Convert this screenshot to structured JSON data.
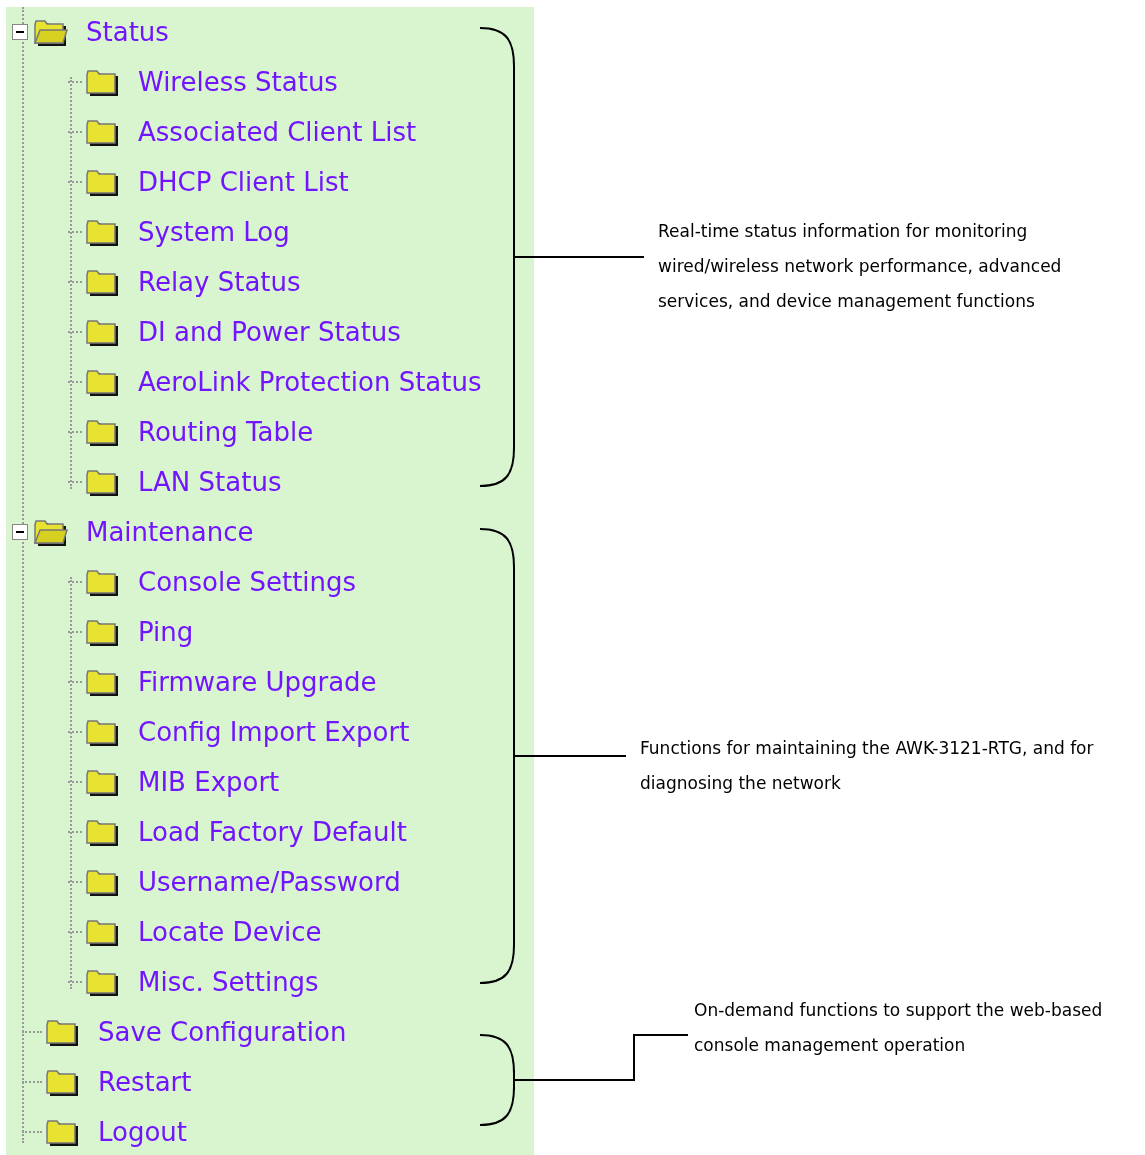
{
  "tree": [
    {
      "label": "Status",
      "expanded": true,
      "children": [
        {
          "label": "Wireless Status"
        },
        {
          "label": "Associated Client List"
        },
        {
          "label": "DHCP Client List"
        },
        {
          "label": "System Log"
        },
        {
          "label": "Relay Status"
        },
        {
          "label": "DI and Power Status"
        },
        {
          "label": "AeroLink Protection Status"
        },
        {
          "label": "Routing Table"
        },
        {
          "label": "LAN Status"
        }
      ]
    },
    {
      "label": "Maintenance",
      "expanded": true,
      "children": [
        {
          "label": "Console Settings"
        },
        {
          "label": "Ping"
        },
        {
          "label": "Firmware Upgrade"
        },
        {
          "label": "Config Import Export"
        },
        {
          "label": "MIB Export"
        },
        {
          "label": "Load Factory Default"
        },
        {
          "label": "Username/Password"
        },
        {
          "label": "Locate Device"
        },
        {
          "label": "Misc. Settings"
        }
      ]
    },
    {
      "label": "Save Configuration"
    },
    {
      "label": "Restart"
    },
    {
      "label": "Logout"
    }
  ],
  "annotations": [
    {
      "text": "Real-time status information for monitoring wired/wireless network performance, advanced services, and device management functions"
    },
    {
      "text": "Functions for maintaining the AWK-3121-RTG, and for diagnosing the network"
    },
    {
      "text": "On-demand functions to support the web-based console management operation"
    }
  ]
}
